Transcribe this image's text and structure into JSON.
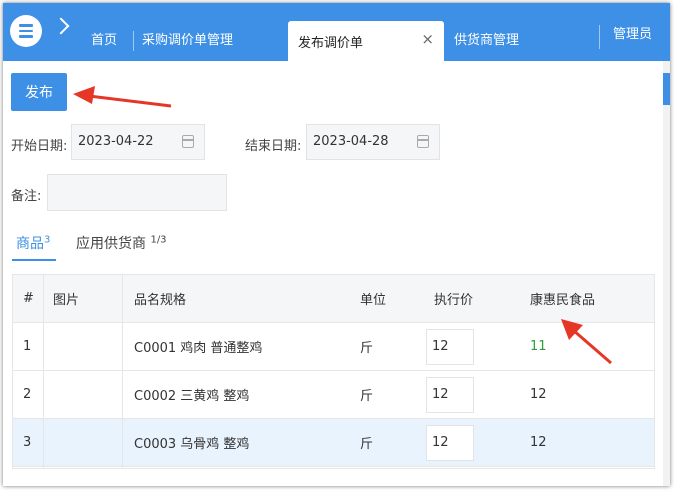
{
  "topbar": {
    "nav": [
      "首页",
      "采购调价单管理"
    ],
    "active_tab": "发布调价单",
    "next_tab": "供货商管理",
    "user": "管理员",
    "close_glyph": "×"
  },
  "toolbar": {
    "publish_label": "发布"
  },
  "form": {
    "start_label": "开始日期:",
    "start_value": "2023-04-22",
    "end_label": "结束日期:",
    "end_value": "2023-04-28",
    "note_label": "备注:",
    "note_value": ""
  },
  "subtabs": [
    {
      "label": "商品",
      "count": "3"
    },
    {
      "label": "应用供货商",
      "count": "1/3"
    }
  ],
  "table": {
    "headers": [
      "#",
      "图片",
      "品名规格",
      "单位",
      "执行价",
      "康惠民食品"
    ],
    "rows": [
      {
        "no": "1",
        "name": "C0001 鸡肉 普通整鸡",
        "unit": "斤",
        "price": "12",
        "supplier": "11"
      },
      {
        "no": "2",
        "name": "C0002 三黄鸡 整鸡",
        "unit": "斤",
        "price": "12",
        "supplier": "12"
      },
      {
        "no": "3",
        "name": "C0003 乌骨鸡 整鸡",
        "unit": "斤",
        "price": "12",
        "supplier": "12"
      }
    ]
  },
  "colors": {
    "accent": "#3e90e6",
    "changed_value": "#2e9e3d",
    "arrow": "#e53626"
  }
}
